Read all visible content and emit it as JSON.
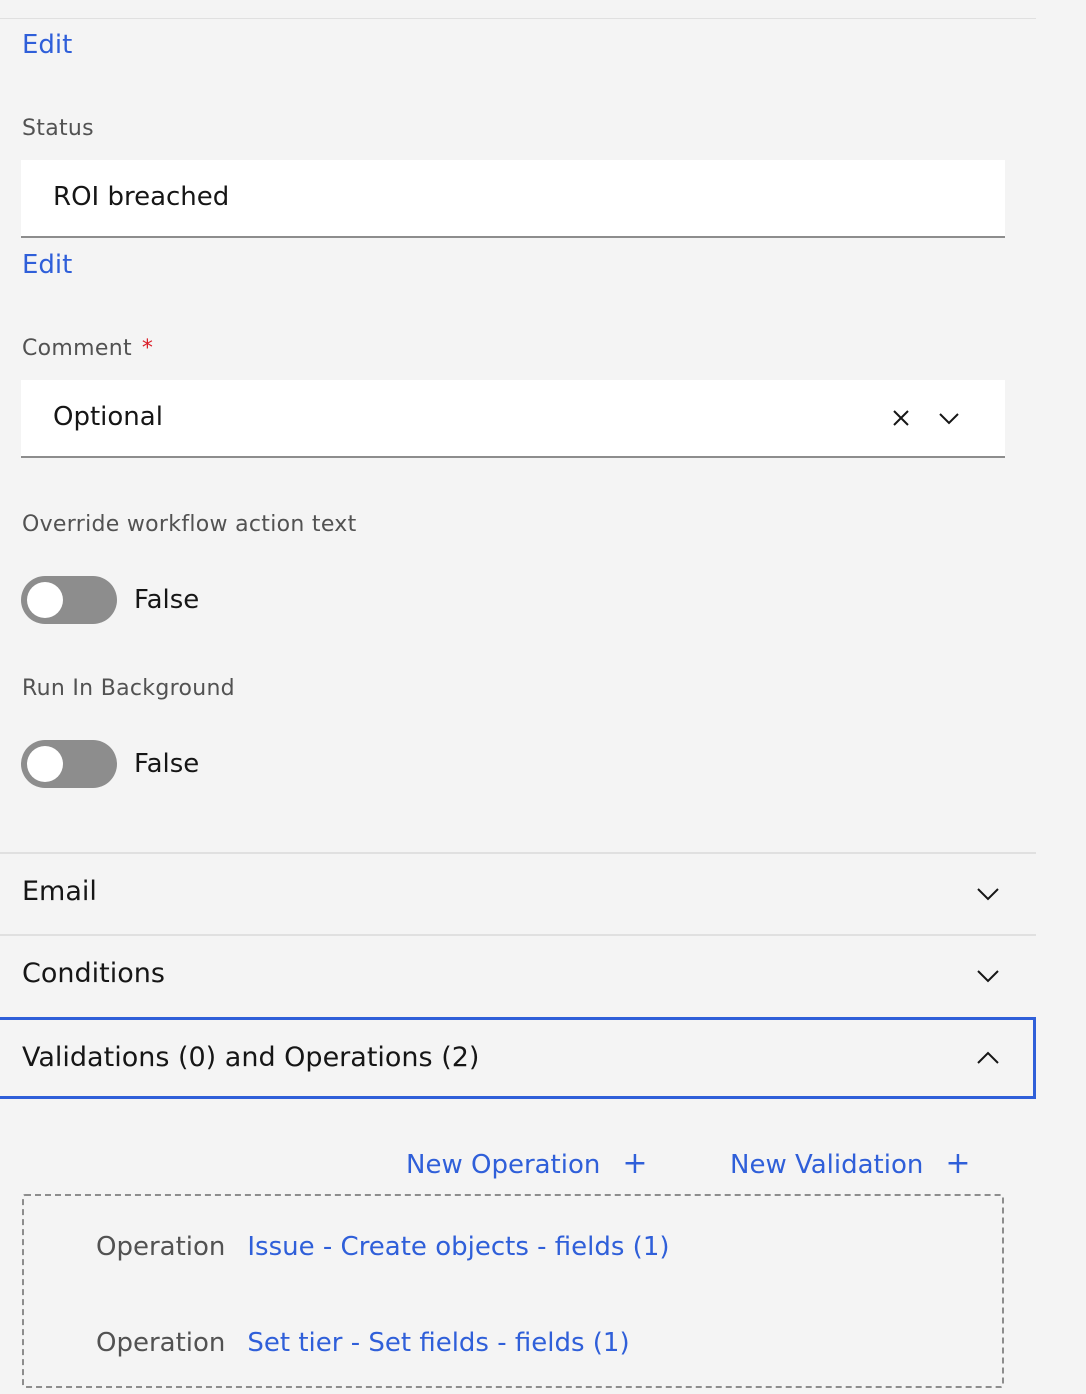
{
  "top_edit": "Edit",
  "status": {
    "label": "Status",
    "value": "ROI breached",
    "edit": "Edit"
  },
  "comment": {
    "label": "Comment",
    "required_marker": "*",
    "value": "Optional",
    "icons": [
      "close-icon",
      "chevron-down-icon"
    ]
  },
  "override": {
    "label": "Override workflow action text",
    "state": "False"
  },
  "background": {
    "label": "Run In Background",
    "state": "False"
  },
  "accordion": [
    {
      "title": "Email",
      "expanded": false
    },
    {
      "title": "Conditions",
      "expanded": false
    },
    {
      "title": "Validations (0) and Operations (2)",
      "expanded": true
    }
  ],
  "actions": {
    "new_operation": "New Operation",
    "new_validation": "New Validation",
    "plus": "+"
  },
  "operations": [
    {
      "type": "Operation",
      "name": "Issue - Create objects - fields (1)"
    },
    {
      "type": "Operation",
      "name": "Set tier - Set fields - fields (1)"
    }
  ],
  "colors": {
    "link": "#2f5fd9",
    "focus": "#2f5fd9",
    "required": "#da1e28"
  }
}
